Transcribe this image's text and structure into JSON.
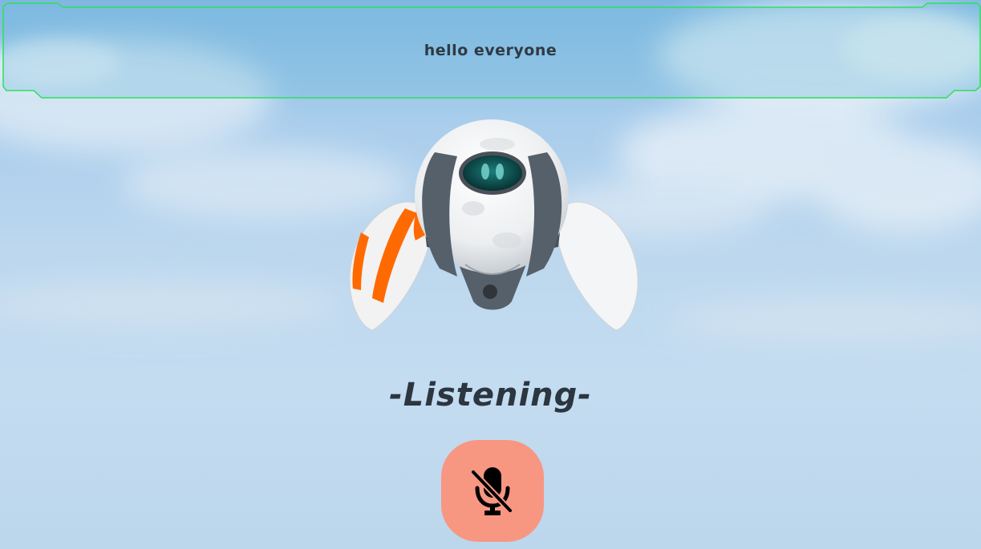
{
  "banner": {
    "message": "hello everyone"
  },
  "status": {
    "text": "-Listening-"
  },
  "mic_button": {
    "icon": "microphone-off-icon",
    "state": "muted",
    "color": "#f79782"
  },
  "colors": {
    "banner_border": "#2ee05a",
    "sky_top": "#7fb7e2",
    "sky_bottom": "#c4dcf0",
    "robot_accent": "#ff6a00"
  }
}
